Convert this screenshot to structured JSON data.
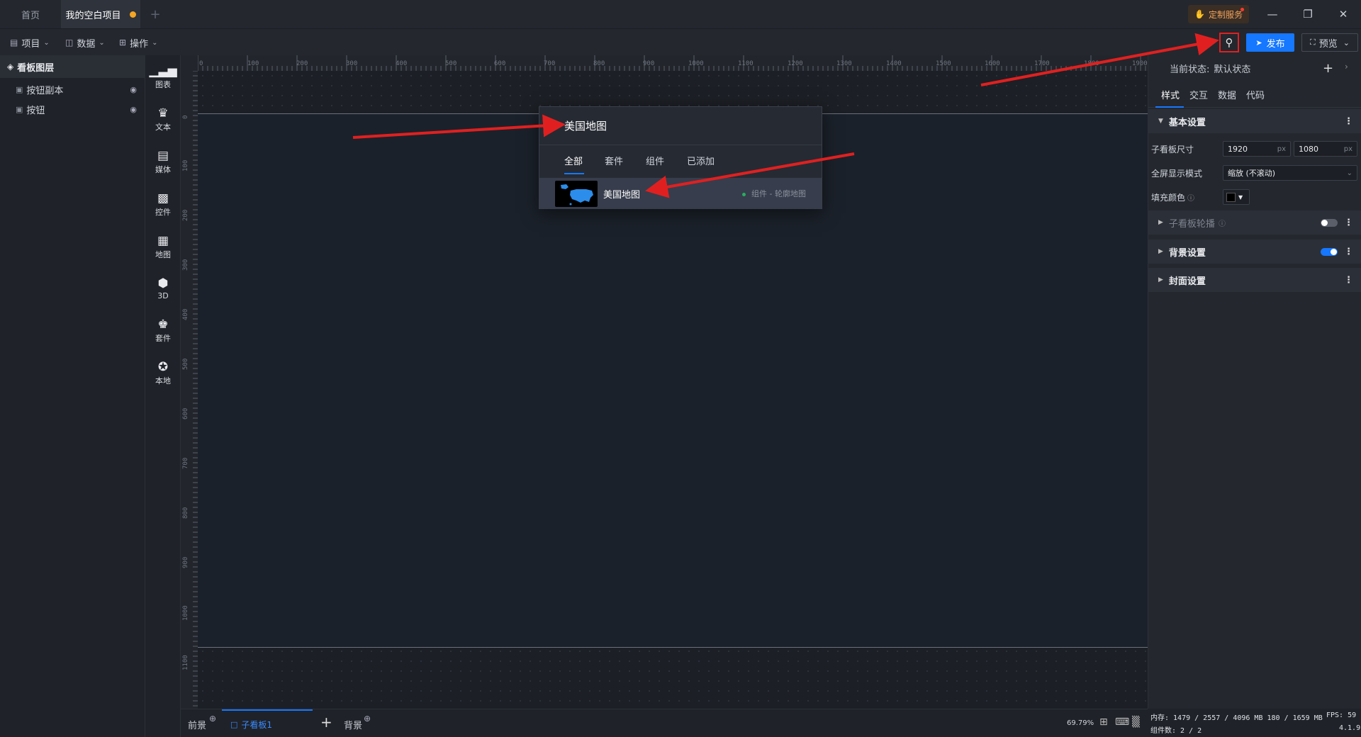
{
  "window": {
    "tabs": [
      {
        "label": "首页"
      },
      {
        "label": "我的空白项目"
      }
    ],
    "add_tab_icon": "plus-icon",
    "custom_service": "定制服务",
    "controls": [
      "minimize-icon",
      "restore-icon",
      "close-icon"
    ]
  },
  "toolbar": {
    "menus": [
      {
        "label": "项目"
      },
      {
        "label": "数据"
      },
      {
        "label": "操作"
      }
    ],
    "publish_label": "发布",
    "preview_label": "预览"
  },
  "layers": {
    "title": "看板图层",
    "items": [
      {
        "label": "按钮副本"
      },
      {
        "label": "按钮"
      }
    ]
  },
  "components": {
    "items": [
      {
        "label": "图表",
        "icon": "chart-icon"
      },
      {
        "label": "文本",
        "icon": "text-icon"
      },
      {
        "label": "媒体",
        "icon": "media-icon"
      },
      {
        "label": "控件",
        "icon": "widget-icon"
      },
      {
        "label": "地图",
        "icon": "map-icon"
      },
      {
        "label": "3D",
        "icon": "cube-icon"
      },
      {
        "label": "套件",
        "icon": "kit-icon"
      },
      {
        "label": "本地",
        "icon": "puzzle-icon"
      }
    ]
  },
  "ruler": {
    "top": [
      "0",
      "100",
      "200",
      "300",
      "400",
      "500",
      "600",
      "700",
      "800",
      "900",
      "1000",
      "1100",
      "1200",
      "1300",
      "1400",
      "1500",
      "1600",
      "1700",
      "1800",
      "1900"
    ],
    "left": [
      "0",
      "100",
      "200",
      "300",
      "400",
      "500",
      "600",
      "700",
      "800",
      "900",
      "1000",
      "1100"
    ]
  },
  "search_popup": {
    "query": "美国地图",
    "tabs": [
      {
        "label": "全部"
      },
      {
        "label": "套件"
      },
      {
        "label": "组件"
      },
      {
        "label": "已添加"
      }
    ],
    "result": {
      "name": "美国地图",
      "tag": "组件 - 轮廓地图"
    }
  },
  "right_panel": {
    "state_label": "当前状态:",
    "state_value": "默认状态",
    "tabs": [
      {
        "label": "样式"
      },
      {
        "label": "交互"
      },
      {
        "label": "数据"
      },
      {
        "label": "代码"
      }
    ],
    "basic_settings": "基本设置",
    "size_label": "子看板尺寸",
    "width": "1920",
    "height": "1080",
    "unit": "px",
    "fullscreen_label": "全屏显示模式",
    "fullscreen_value": "缩放 (不滚动)",
    "fill_label": "填充颜色",
    "fill_color": "#000000",
    "carousel": "子看板轮播",
    "background": "背景设置",
    "cover": "封面设置"
  },
  "bottom_bar": {
    "foreground": "前景",
    "sub_board": "子看板1",
    "background": "背景",
    "zoom": "69.79%"
  },
  "status": {
    "memory": "内存: 1479 / 2557 / 4096 MB 180 / 1659 MB",
    "fps": "FPS: 59",
    "components": "组件数: 2 / 2",
    "version": "4.1.9"
  },
  "colors": {
    "accent": "#1677ff",
    "annotation": "#e02020",
    "highlight": "#f5a623"
  }
}
